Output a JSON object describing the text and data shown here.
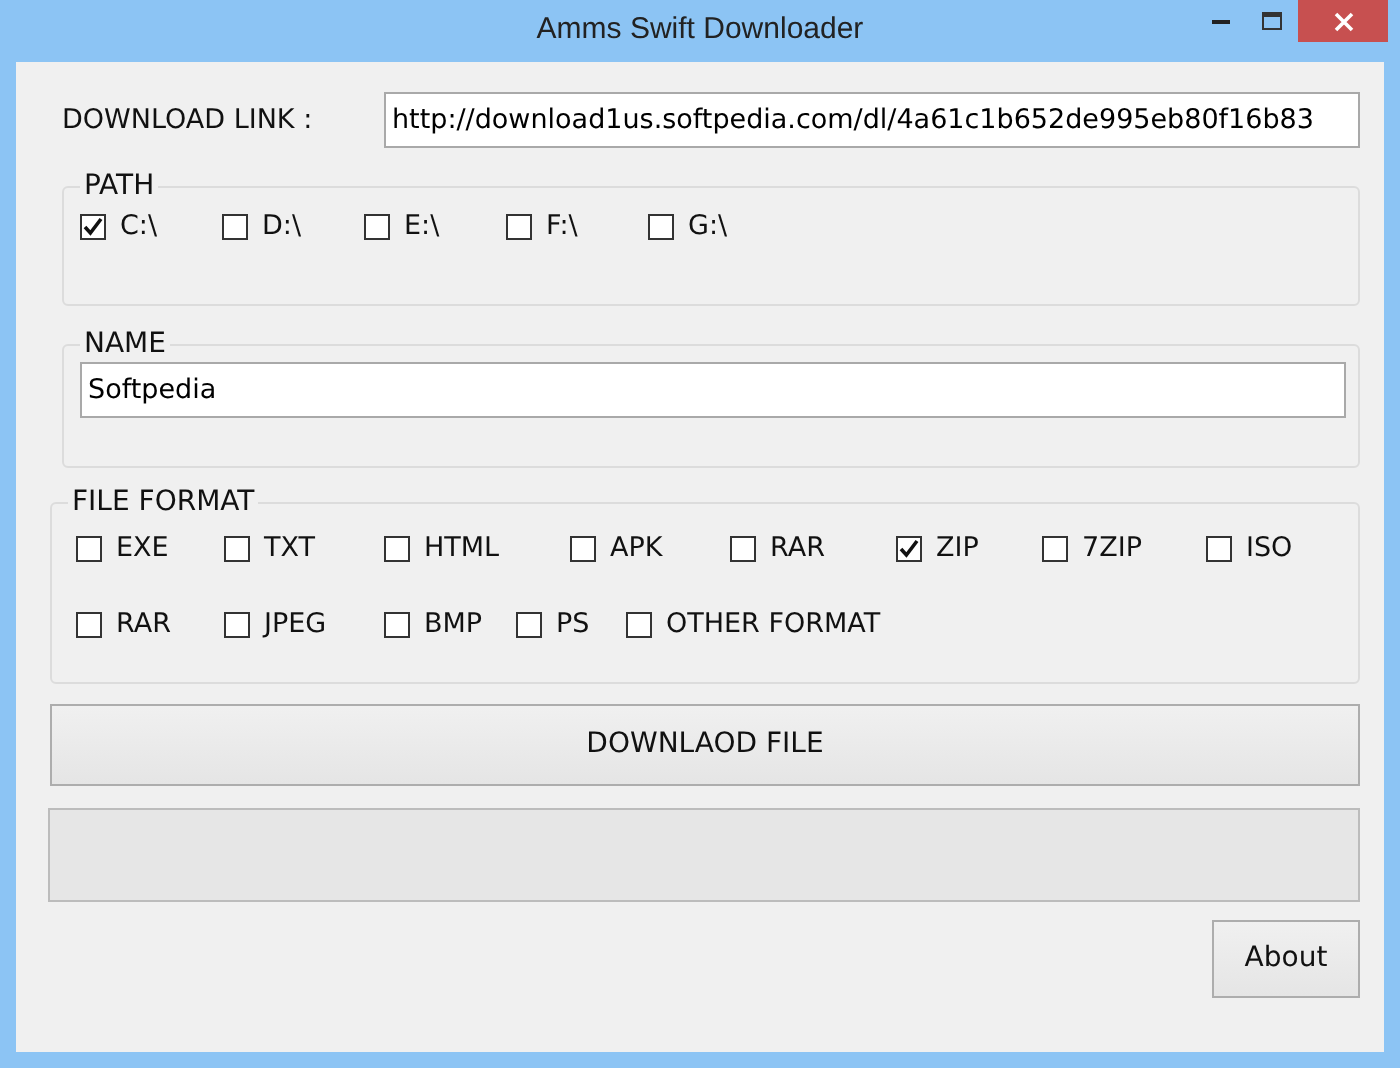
{
  "window": {
    "title": "Amms Swift Downloader"
  },
  "download_link": {
    "label": "DOWNLOAD LINK :",
    "value": "http://download1us.softpedia.com/dl/4a61c1b652de995eb80f16b83"
  },
  "path": {
    "title": "PATH",
    "drives": [
      {
        "label": "C:\\",
        "checked": true
      },
      {
        "label": "D:\\",
        "checked": false
      },
      {
        "label": "E:\\",
        "checked": false
      },
      {
        "label": "F:\\",
        "checked": false
      },
      {
        "label": "G:\\",
        "checked": false
      }
    ]
  },
  "name": {
    "title": "NAME",
    "value": "Softpedia"
  },
  "file_format": {
    "title": "FILE FORMAT",
    "rows": [
      [
        {
          "label": "EXE",
          "checked": false
        },
        {
          "label": "TXT",
          "checked": false
        },
        {
          "label": "HTML",
          "checked": false
        },
        {
          "label": "APK",
          "checked": false
        },
        {
          "label": "RAR",
          "checked": false
        },
        {
          "label": "ZIP",
          "checked": true
        },
        {
          "label": "7ZIP",
          "checked": false
        },
        {
          "label": "ISO",
          "checked": false
        }
      ],
      [
        {
          "label": "RAR",
          "checked": false
        },
        {
          "label": "JPEG",
          "checked": false
        },
        {
          "label": "BMP",
          "checked": false
        },
        {
          "label": "PS",
          "checked": false
        },
        {
          "label": "OTHER FORMAT",
          "checked": false
        }
      ]
    ]
  },
  "download_button": "DOWNLAOD FILE",
  "about_button": "About"
}
